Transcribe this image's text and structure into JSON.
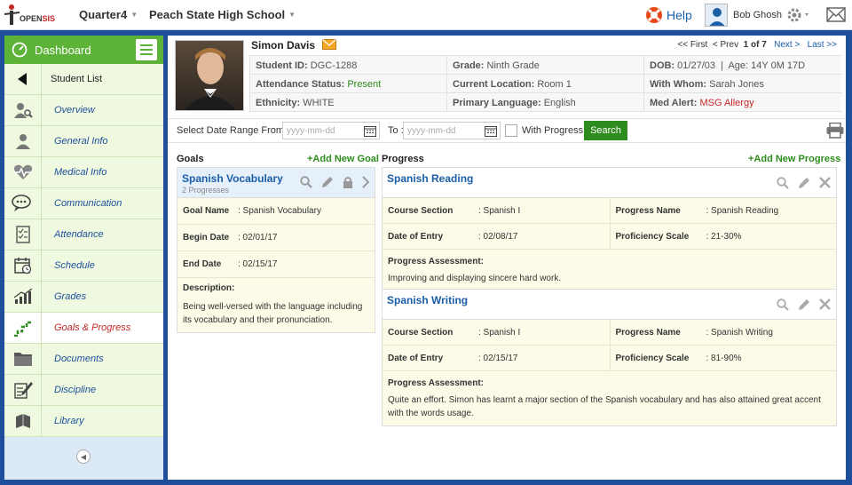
{
  "topbar": {
    "logo_text_left": "OPEN",
    "logo_text_right": "SIS",
    "quarter": "Quarter4",
    "school": "Peach State High School",
    "help": "Help",
    "user_name": "Bob Ghosh"
  },
  "sidebar": {
    "dashboard": "Dashboard",
    "back_label": "Student List",
    "items": [
      {
        "label": "Overview",
        "icon": "user-search-icon"
      },
      {
        "label": "General Info",
        "icon": "user-icon"
      },
      {
        "label": "Medical Info",
        "icon": "heartbeat-icon"
      },
      {
        "label": "Communication",
        "icon": "chat-icon"
      },
      {
        "label": "Attendance",
        "icon": "checklist-icon"
      },
      {
        "label": "Schedule",
        "icon": "calendar-clock-icon"
      },
      {
        "label": "Grades",
        "icon": "chart-icon"
      },
      {
        "label": "Goals & Progress",
        "icon": "stairs-icon"
      },
      {
        "label": "Documents",
        "icon": "folder-icon"
      },
      {
        "label": "Discipline",
        "icon": "pencil-paper-icon"
      },
      {
        "label": "Library",
        "icon": "books-icon"
      }
    ]
  },
  "student": {
    "name": "Simon Davis",
    "pager": {
      "first": "<< First",
      "prev": "< Prev",
      "position": "1 of 7",
      "next": "Next >",
      "last": "Last >>"
    },
    "info": [
      [
        {
          "label": "Student ID:",
          "value": "DGC-1288"
        },
        {
          "label": "Grade:",
          "value": "Ninth Grade"
        },
        {
          "label": "DOB:",
          "value": "01/27/03  |  Age: 14Y 0M 17D"
        }
      ],
      [
        {
          "label": "Attendance Status:",
          "value": "Present"
        },
        {
          "label": "Current Location:",
          "value": "Room 1"
        },
        {
          "label": "With Whom:",
          "value": "Sarah Jones"
        }
      ],
      [
        {
          "label": "Ethnicity:",
          "value": "WHITE"
        },
        {
          "label": "Primary Language:",
          "value": "English"
        },
        {
          "label": "Med Alert:",
          "value": "MSG Allergy"
        }
      ]
    ]
  },
  "filter": {
    "range_label": "Select Date Range From :",
    "from_placeholder": "yyyy-mm-dd",
    "to_label": "To :",
    "to_placeholder": "yyyy-mm-dd",
    "with_progress": "With Progress",
    "search": "Search"
  },
  "goals": {
    "title": "Goals",
    "add": "+Add New Goal",
    "card": {
      "title": "Spanish Vocabulary",
      "subtitle": "2 Progresses",
      "goal_name_label": "Goal Name",
      "goal_name": ": Spanish Vocabulary",
      "begin_label": "Begin Date",
      "begin": ": 02/01/17",
      "end_label": "End Date",
      "end": ": 02/15/17",
      "desc_label": "Description:",
      "desc": "Being well-versed with the language including its vocabulary and their pronunciation."
    }
  },
  "progress": {
    "title": "Progress",
    "add": "+Add New Progress",
    "cards": [
      {
        "title": "Spanish Reading",
        "course_label": "Course Section",
        "course": ": Spanish I",
        "name_label": "Progress Name",
        "name": ": Spanish Reading",
        "date_label": "Date of Entry",
        "date": ": 02/08/17",
        "scale_label": "Proficiency Scale",
        "scale": ": 21-30%",
        "assess_label": "Progress Assessment:",
        "assess": "Improving and displaying sincere hard work."
      },
      {
        "title": "Spanish Writing",
        "course_label": "Course Section",
        "course": ": Spanish I",
        "name_label": "Progress Name",
        "name": ": Spanish Writing",
        "date_label": "Date of Entry",
        "date": ": 02/15/17",
        "scale_label": "Proficiency Scale",
        "scale": ": 81-90%",
        "assess_label": "Progress Assessment:",
        "assess": "Quite an effort. Simon has learnt a major section of the Spanish vocabulary and has also attained great accent with the words usage."
      }
    ]
  }
}
